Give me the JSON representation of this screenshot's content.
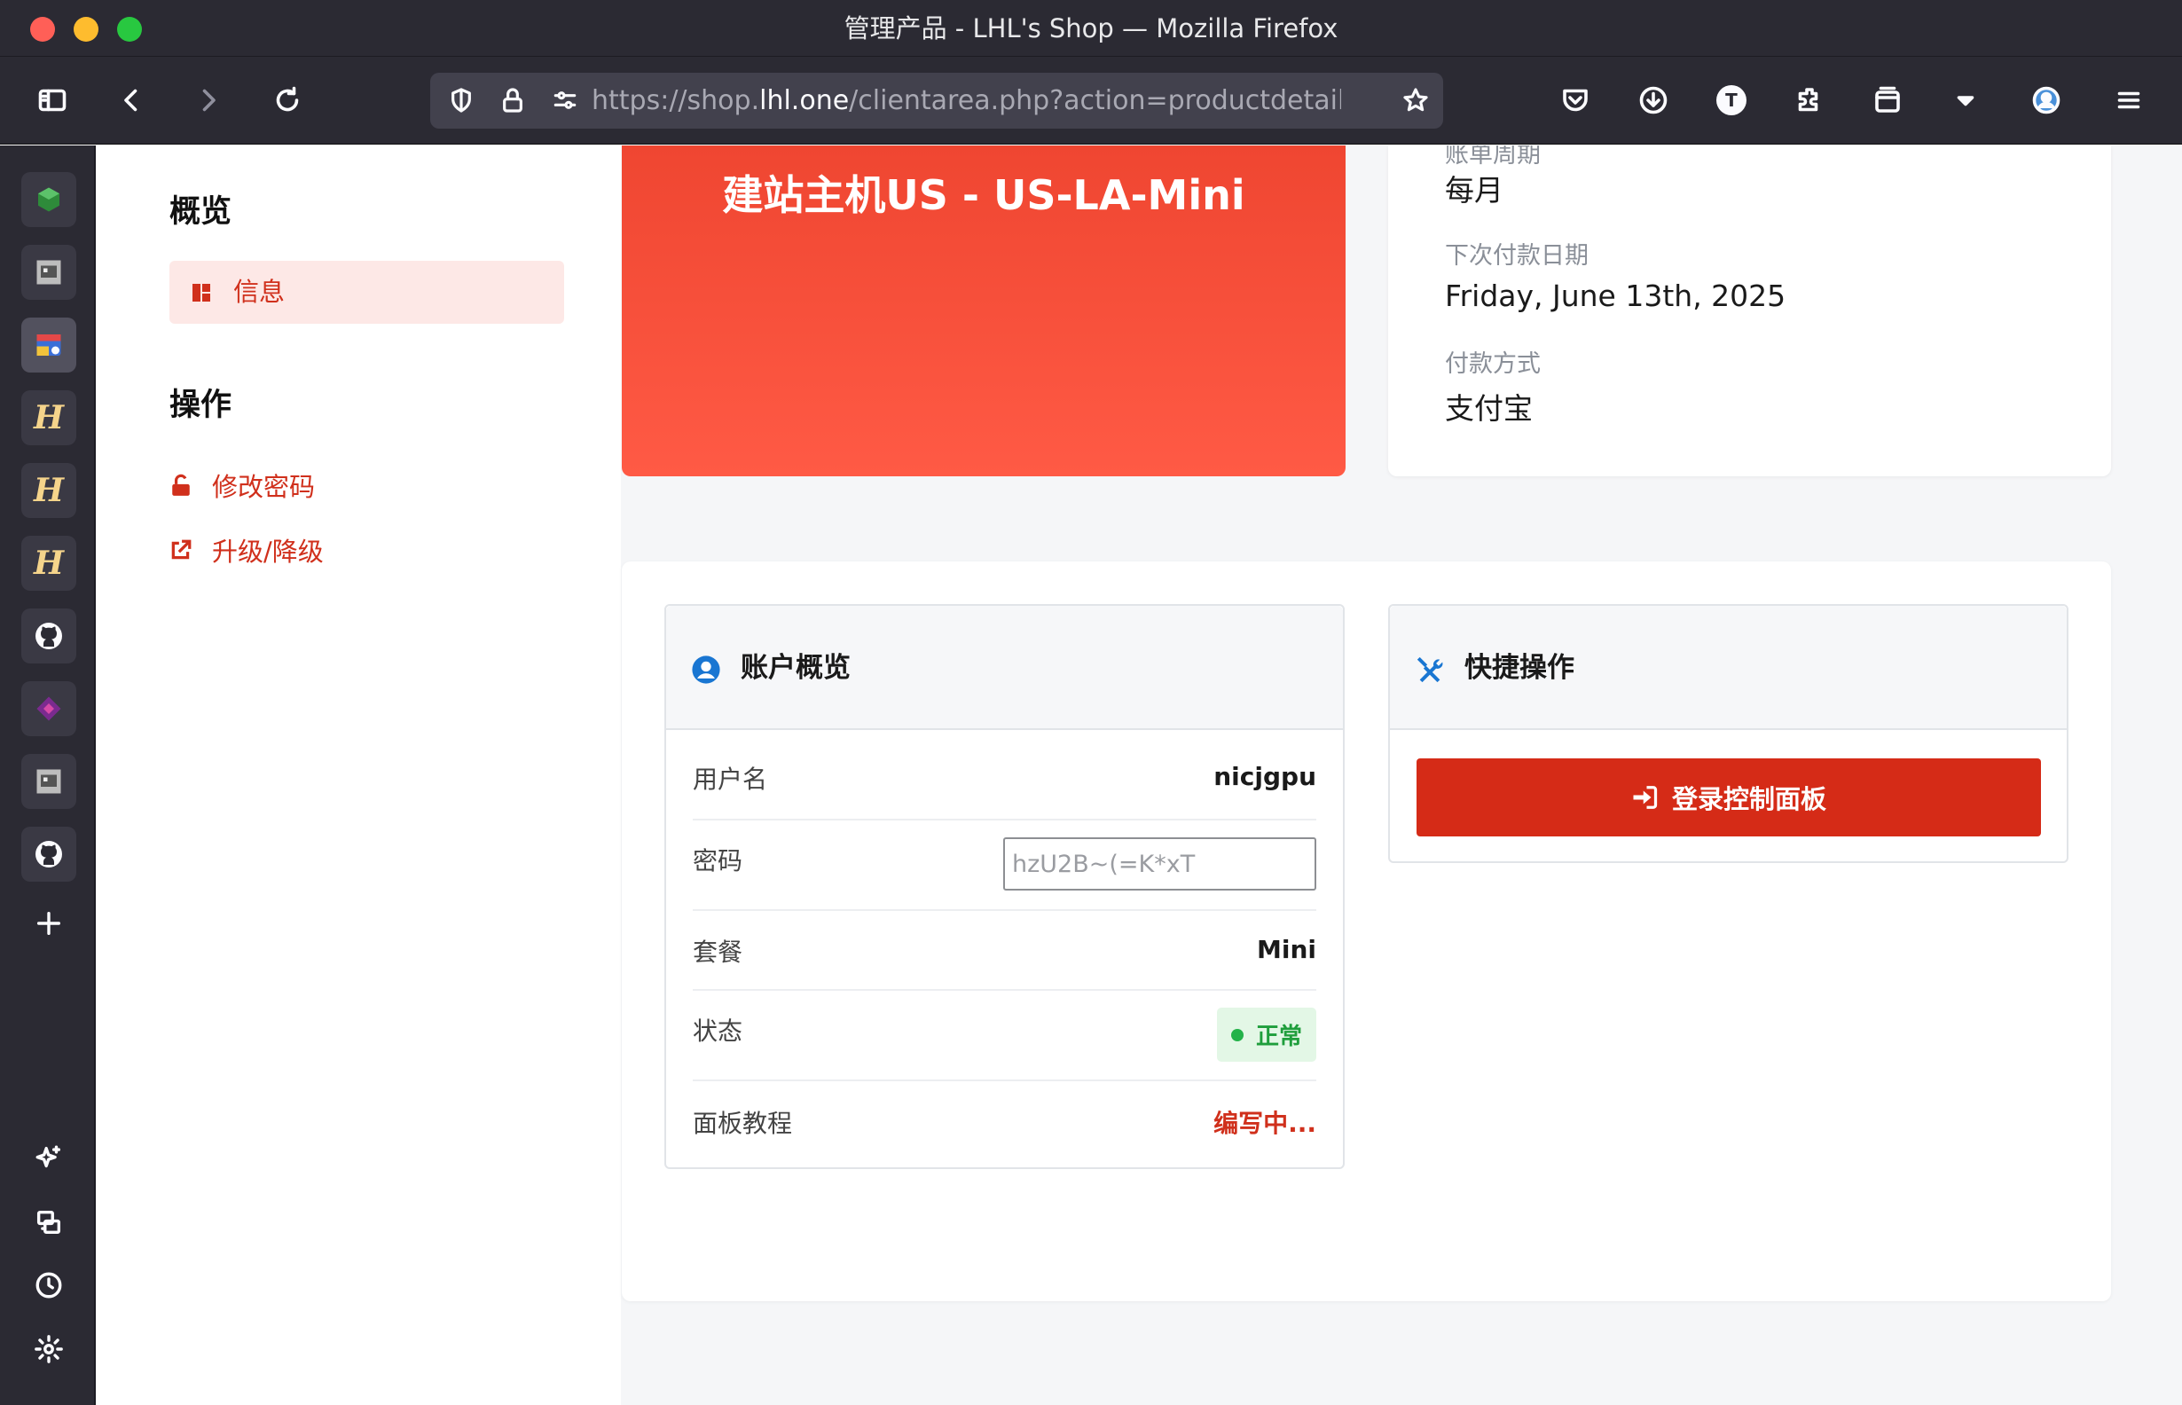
{
  "window": {
    "title": "管理产品 - LHL's Shop — Mozilla Firefox"
  },
  "toolbar": {
    "url_prefix": "https://shop.",
    "url_domain": "lhl.one",
    "url_rest": "/clientarea.php?action=productdetails#",
    "profile_letter": "T"
  },
  "sidebar_nav": {
    "overview_heading": "概览",
    "info_label": "信息",
    "actions_heading": "操作",
    "change_password_label": "修改密码",
    "upgrade_label": "升级/降级"
  },
  "product": {
    "title": "建站主机US - US-LA-Mini"
  },
  "billing": {
    "cycle_label": "账单周期",
    "cycle_value": "每月",
    "next_due_label": "下次付款日期",
    "next_due_value": "Friday, June 13th, 2025",
    "payment_method_label": "付款方式",
    "payment_method_value": "支付宝"
  },
  "account_overview": {
    "title": "账户概览",
    "username_label": "用户名",
    "username_value": "nicjgpu",
    "password_label": "密码",
    "password_value": "hzU2B~(=K*xT",
    "plan_label": "套餐",
    "plan_value": "Mini",
    "status_label": "状态",
    "status_value": "正常",
    "tutorial_label": "面板教程",
    "tutorial_value": "编写中..."
  },
  "quick_actions": {
    "title": "快捷操作",
    "login_button": "登录控制面板"
  },
  "colors": {
    "brand_red": "#d52b17",
    "banner_top": "#ef4631",
    "banner_bottom": "#ff5a45",
    "status_green": "#23b249",
    "accent_blue": "#1976d2"
  },
  "icons": {
    "toolbar": [
      "sidebar-toggle-icon",
      "back-icon",
      "forward-icon",
      "reload-icon",
      "shield-icon",
      "lock-icon",
      "permissions-icon",
      "bookmark-star-icon",
      "pocket-icon",
      "download-icon",
      "profile-icon",
      "extensions-icon",
      "container-icon",
      "dropdown-icon",
      "account-icon",
      "menu-icon"
    ],
    "sidebar": [
      "green-cube-icon",
      "web-app-icon",
      "rss-app-icon",
      "h-logo-icon",
      "github-icon",
      "purple-diamond-icon",
      "add-icon",
      "ai-sparkle-icon",
      "synced-tabs-icon",
      "history-icon",
      "settings-icon"
    ]
  }
}
